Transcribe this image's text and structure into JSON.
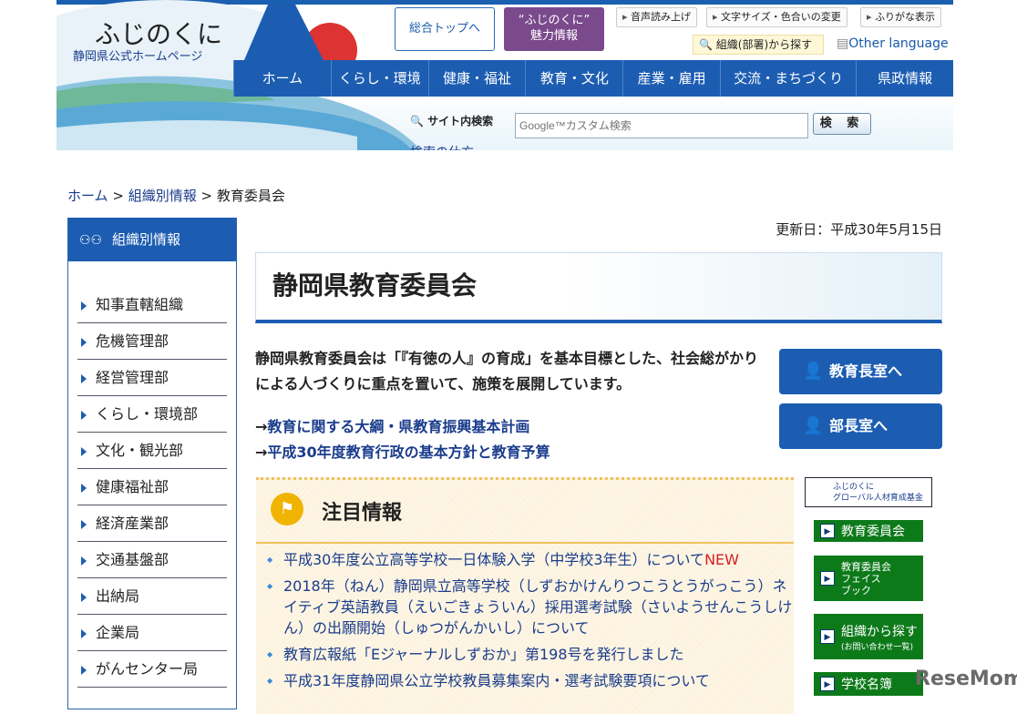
{
  "header": {
    "logo_title": "ふじのくに",
    "logo_sub": "静岡県公式ホームページ",
    "top_button": "総合トップへ",
    "miryoku_line1": "“ふじのくに”",
    "miryoku_line2": "魅力情報",
    "tools": [
      "音声読み上げ",
      "文字サイズ・色合いの変更",
      "ふりがな表示"
    ],
    "org_search": "組織(部署)から探す",
    "other_language": "Other language"
  },
  "nav": [
    "ホーム",
    "くらし・環境",
    "健康・福祉",
    "教育・文化",
    "産業・雇用",
    "交流・まちづくり",
    "県政情報"
  ],
  "search": {
    "label": "サイト内検索",
    "placeholder": "Google™カスタム検索",
    "button": "検 索",
    "help": "検索の仕方"
  },
  "breadcrumb": {
    "home": "ホーム",
    "sep": ">",
    "org": "組織別情報",
    "current": "教育委員会"
  },
  "sidebar": {
    "title": "組織別情報",
    "items": [
      "知事直轄組織",
      "危機管理部",
      "経営管理部",
      "くらし・環境部",
      "文化・観光部",
      "健康福祉部",
      "経済産業部",
      "交通基盤部",
      "出納局",
      "企業局",
      "がんセンター局"
    ]
  },
  "main": {
    "updated": "更新日：平成30年5月15日",
    "title": "静岡県教育委員会",
    "intro": "静岡県教育委員会は「『有徳の人』の育成」を基本目標とした、社会総がかりによる人づくりに重点を置いて、施策を展開しています。",
    "arrow": "→",
    "links": [
      "教育に関する大綱・県教育振興基本計画",
      "平成30年度教育行政の基本方針と教育予算"
    ],
    "buttons": [
      "教育長室へ",
      "部長室へ"
    ]
  },
  "notice": {
    "title": "注目情報",
    "items": [
      "平成30年度公立高等学校一日体験入学（中学校3年生）について",
      "2018年（ねん）静岡県立高等学校（しずおかけんりつこうとうがっこう）ネイティブ英語教員（えいごきょういん）採用選考試験（さいようせんこうしけん）の出願開始（しゅつがんかいし）について",
      "教育広報紙「Eジャーナルしずおか」第198号を発行しました",
      "平成31年度静岡県公立学校教員募集案内・選考試験要項について"
    ],
    "new_label": "NEW"
  },
  "right": {
    "global_line1": "ふじのくに",
    "global_line2": "グローバル人材育成基金",
    "green": [
      "教育委員会",
      "教育委員会",
      "フェイス",
      "ブック",
      "組織から探す",
      "(お問い合わせ一覧)",
      "学校名簿"
    ]
  },
  "watermark": "ReseMom"
}
